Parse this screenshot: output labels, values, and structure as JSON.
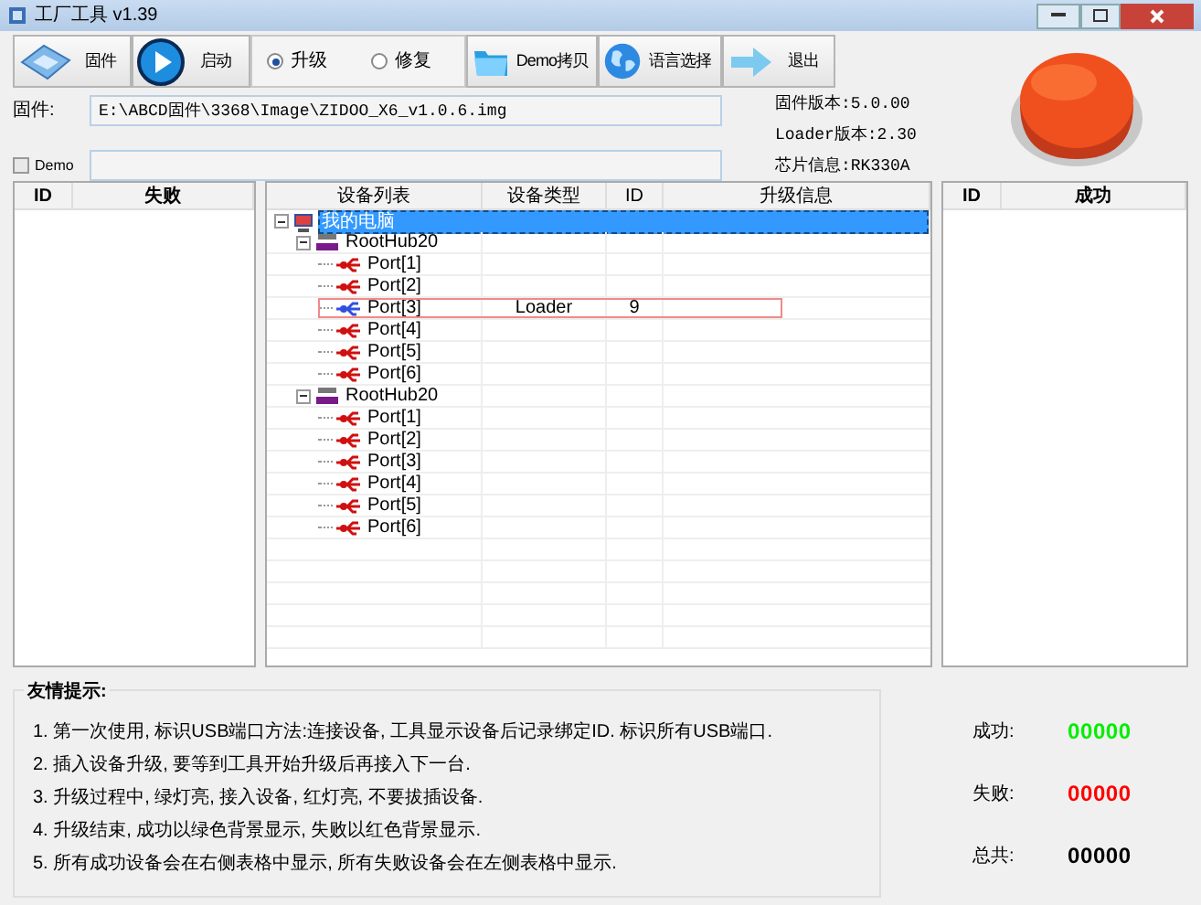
{
  "window": {
    "title": "工厂工具 v1.39"
  },
  "toolbar": {
    "buttons": [
      {
        "kind": "firmware",
        "label": "固件"
      },
      {
        "kind": "start",
        "label": "启动"
      }
    ],
    "modes": [
      {
        "label": "升级",
        "selected": true
      },
      {
        "label": "修复",
        "selected": false
      }
    ],
    "buttons_right": [
      {
        "kind": "folder",
        "label": "Demo拷贝"
      },
      {
        "kind": "globe",
        "label": "语言选择"
      },
      {
        "kind": "exit",
        "label": "退出"
      }
    ]
  },
  "firmware": {
    "label": "固件:",
    "value": "E:\\ABCD固件\\3368\\Image\\ZIDOO_X6_v1.0.6.img"
  },
  "demo": {
    "label": "Demo",
    "checked": false
  },
  "info": [
    "固件版本:5.0.00",
    "Loader版本:2.30",
    "芯片信息:RK330A"
  ],
  "failed_table": {
    "columns": [
      "ID",
      "失败"
    ]
  },
  "device_table": {
    "columns": [
      "设备列表",
      "设备类型",
      "ID",
      "升级信息"
    ],
    "tree": [
      {
        "label": "我的电脑",
        "kind": "computer",
        "selected": true,
        "expanded": true,
        "children": [
          {
            "label": "RootHub20",
            "kind": "hub",
            "expanded": true,
            "selected": false,
            "children": [
              {
                "label": "Port[1]",
                "kind": "port",
                "connected": false,
                "selected": false
              },
              {
                "label": "Port[2]",
                "kind": "port",
                "connected": false,
                "selected": false
              },
              {
                "label": "Port[3]",
                "kind": "port",
                "connected": true,
                "selected": false,
                "type": "Loader",
                "id": "9"
              },
              {
                "label": "Port[4]",
                "kind": "port",
                "connected": false,
                "selected": false
              },
              {
                "label": "Port[5]",
                "kind": "port",
                "connected": false,
                "selected": false
              },
              {
                "label": "Port[6]",
                "kind": "port",
                "connected": false,
                "selected": false
              }
            ]
          },
          {
            "label": "RootHub20",
            "kind": "hub",
            "expanded": true,
            "selected": false,
            "children": [
              {
                "label": "Port[1]",
                "kind": "port",
                "connected": false,
                "selected": false
              },
              {
                "label": "Port[2]",
                "kind": "port",
                "connected": false,
                "selected": false
              },
              {
                "label": "Port[3]",
                "kind": "port",
                "connected": false,
                "selected": false
              },
              {
                "label": "Port[4]",
                "kind": "port",
                "connected": false,
                "selected": false
              },
              {
                "label": "Port[5]",
                "kind": "port",
                "connected": false,
                "selected": false
              },
              {
                "label": "Port[6]",
                "kind": "port",
                "connected": false,
                "selected": false
              }
            ]
          }
        ]
      }
    ]
  },
  "success_table": {
    "columns": [
      "ID",
      "成功"
    ]
  },
  "tips": {
    "title": "友情提示:",
    "items": [
      "1. 第一次使用, 标识USB端口方法:连接设备, 工具显示设备后记录绑定ID. 标识所有USB端口.",
      "2. 插入设备升级, 要等到工具开始升级后再接入下一台.",
      "3. 升级过程中, 绿灯亮, 接入设备, 红灯亮, 不要拔插设备.",
      "4. 升级结束, 成功以绿色背景显示, 失败以红色背景显示.",
      "5. 所有成功设备会在右侧表格中显示, 所有失败设备会在左侧表格中显示."
    ]
  },
  "counts": [
    {
      "label": "成功:",
      "value": "00000",
      "color": "#00ee00"
    },
    {
      "label": "失败:",
      "value": "00000",
      "color": "#ff0000"
    },
    {
      "label": "总共:",
      "value": "00000",
      "color": "#000000"
    }
  ]
}
